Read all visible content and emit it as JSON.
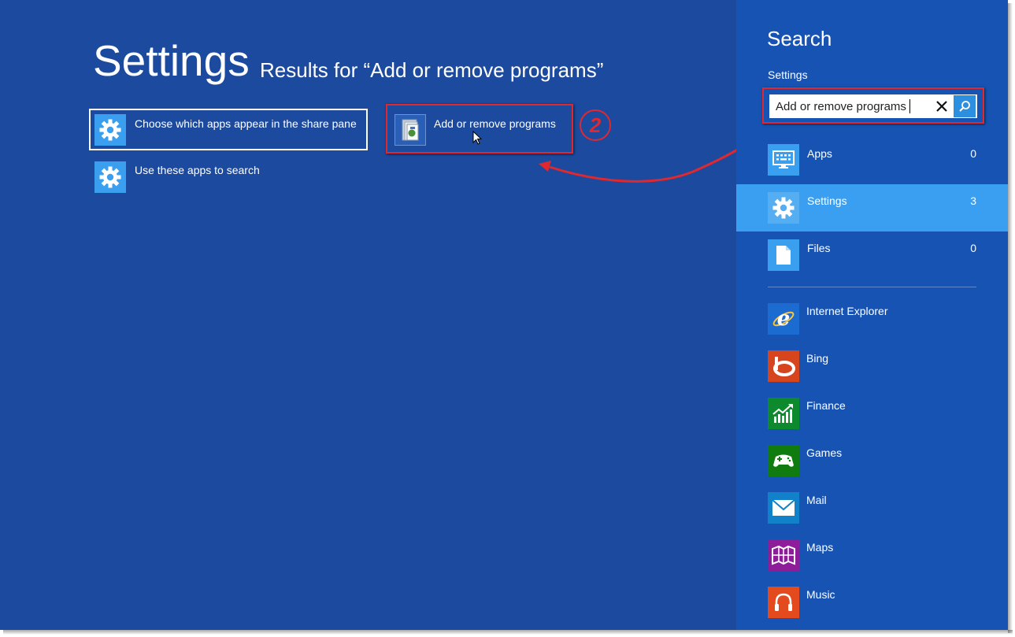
{
  "results": {
    "title": "Settings",
    "subtitle": "Results for “Add or remove programs”",
    "items": [
      {
        "label": "Choose which apps appear in the share pane",
        "icon": "gear-icon"
      },
      {
        "label": "Use these apps to search",
        "icon": "gear-icon"
      },
      {
        "label": "Add or remove programs",
        "icon": "programs-icon"
      }
    ],
    "step_badge": "2"
  },
  "charm": {
    "title": "Search",
    "scope_label": "Settings",
    "search": {
      "value": "Add or remove programs",
      "placeholder": ""
    },
    "scopes": [
      {
        "label": "Apps",
        "count": "0",
        "icon": "apps-keyboard-icon"
      },
      {
        "label": "Settings",
        "count": "3",
        "icon": "gear-icon",
        "selected": true
      },
      {
        "label": "Files",
        "count": "0",
        "icon": "file-icon"
      }
    ],
    "apps": [
      {
        "label": "Internet Explorer",
        "icon": "internet-explorer-icon",
        "color": "#1c6bd1"
      },
      {
        "label": "Bing",
        "icon": "bing-icon",
        "color": "#d6451d"
      },
      {
        "label": "Finance",
        "icon": "finance-icon",
        "color": "#0d8a2e"
      },
      {
        "label": "Games",
        "icon": "games-icon",
        "color": "#107c10"
      },
      {
        "label": "Mail",
        "icon": "mail-icon",
        "color": "#1181c9"
      },
      {
        "label": "Maps",
        "icon": "maps-icon",
        "color": "#8e1d9a"
      },
      {
        "label": "Music",
        "icon": "music-icon",
        "color": "#e34b1e"
      }
    ]
  },
  "colors": {
    "background": "#1c4a9e",
    "charm_background": "#1753b3",
    "selected_row": "#3a9ff0",
    "annotation_red": "#e0282f"
  }
}
